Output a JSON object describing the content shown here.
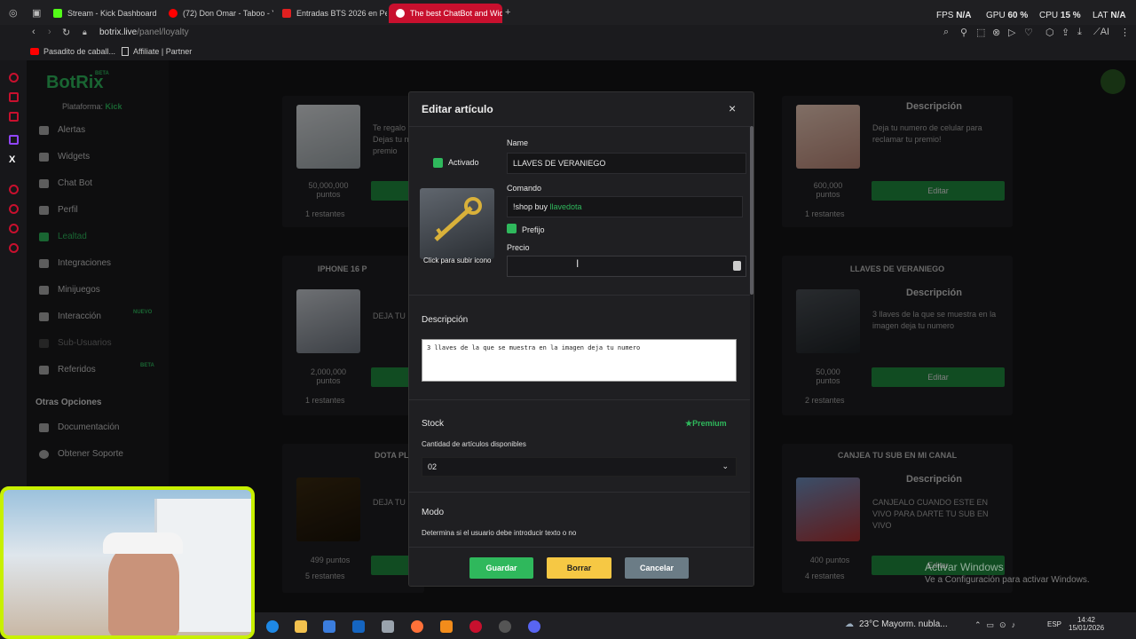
{
  "browser": {
    "tabs": [
      {
        "label": "Stream - Kick Dashboard",
        "color": "#53fc18"
      },
      {
        "label": "(72) Don Omar - Taboo - Y",
        "color": "#ff0000"
      },
      {
        "label": "Entradas BTS 2026 en Per",
        "color": "#e02020"
      },
      {
        "label": "The best ChatBot and Wid",
        "color": "#ffffff"
      }
    ],
    "stats": {
      "fps_label": "FPS",
      "fps": "N/A",
      "gpu_label": "GPU",
      "gpu": "60 %",
      "cpu_label": "CPU",
      "cpu": "15 %",
      "lat_label": "LAT",
      "lat": "N/A"
    },
    "url_host": "botrix.live",
    "url_path": "/panel/loyalty",
    "bookmarks": [
      {
        "label": "Pasadito de caball..."
      },
      {
        "label": "Affiliate | Partner"
      }
    ]
  },
  "sidebar": {
    "logo": "BotRix",
    "logo_badge": "BETA",
    "platform_label": "Plataforma:",
    "platform_value": "Kick",
    "items": [
      {
        "label": "Alertas"
      },
      {
        "label": "Widgets"
      },
      {
        "label": "Chat Bot"
      },
      {
        "label": "Perfil"
      },
      {
        "label": "Lealtad"
      },
      {
        "label": "Integraciones"
      },
      {
        "label": "Minijuegos"
      },
      {
        "label": "Interacción",
        "badge": "NUEVO"
      },
      {
        "label": "Sub-Usuarios"
      },
      {
        "label": "Referidos",
        "badge": "BETA"
      }
    ],
    "other_header": "Otras Opciones",
    "other_items": [
      {
        "label": "Documentación"
      },
      {
        "label": "Obtener Soporte"
      }
    ]
  },
  "cards": [
    {
      "title": "",
      "desc": "Te regalo\nDejas tu n\npremio",
      "price": "50,000,000\npuntos",
      "rest": "1 restantes"
    },
    {
      "title": "IPHONE 16 P",
      "desc": "DEJA TU",
      "price": "2,000,000\npuntos",
      "rest": "1 restantes"
    },
    {
      "title": "DOTA PL",
      "desc": "DEJA TU",
      "price": "499 puntos",
      "rest": "5 restantes"
    },
    {
      "title": "",
      "desc_h": "Descripción",
      "desc": "Deja tu numero de celular para reclamar tu premio!",
      "price": "600,000\npuntos",
      "rest": "1 restantes",
      "button": "Editar"
    },
    {
      "title": "LLAVES DE VERANIEGO",
      "desc_h": "Descripción",
      "desc": "3 llaves de la que se muestra en la imagen deja tu numero",
      "price": "50,000\npuntos",
      "rest": "2 restantes",
      "button": "Editar"
    },
    {
      "title": "CANJEA TU SUB EN MI CANAL",
      "desc_h": "Descripción",
      "desc": "CANJEALO CUANDO ESTE EN VIVO PARA DARTE TU SUB EN VIVO",
      "price": "400 puntos",
      "rest": "4 restantes",
      "button": "Editar"
    }
  ],
  "modal": {
    "title": "Editar artículo",
    "close": "×",
    "activated_label": "Activado",
    "upload_label": "Click para subir icono",
    "name_label": "Name",
    "name_value": "LLAVES DE VERANIEGO",
    "command_label": "Comando",
    "command_prefix": "!shop buy ",
    "command_value": "llavedota",
    "prefix_label": "Prefijo",
    "price_label": "Precio",
    "price_value": "",
    "description_label": "Descripción",
    "description_value": "3 llaves de la que se muestra en la imagen deja tu numero",
    "stock_label": "Stock",
    "premium_label": "Premium",
    "stock_help": "Cantidad de artículos disponibles",
    "stock_value": "02",
    "mode_label": "Modo",
    "mode_help": "Determina si el usuario debe introducir texto o no",
    "save": "Guardar",
    "delete": "Borrar",
    "cancel": "Cancelar"
  },
  "windows": {
    "activate_title": "Activar Windows",
    "activate_sub": "Ve a Configuración para activar Windows.",
    "weather": "23°C  Mayorm. nubla...",
    "lang": "ESP",
    "time": "14:42",
    "date": "15/01/2026"
  },
  "colors": {
    "green": "#2fb85c",
    "button_green": "#1f8a3e",
    "yellow": "#f6c844",
    "grey_button": "#6b7c86",
    "kick": "#53fc18",
    "brand_red": "#c8102e"
  }
}
